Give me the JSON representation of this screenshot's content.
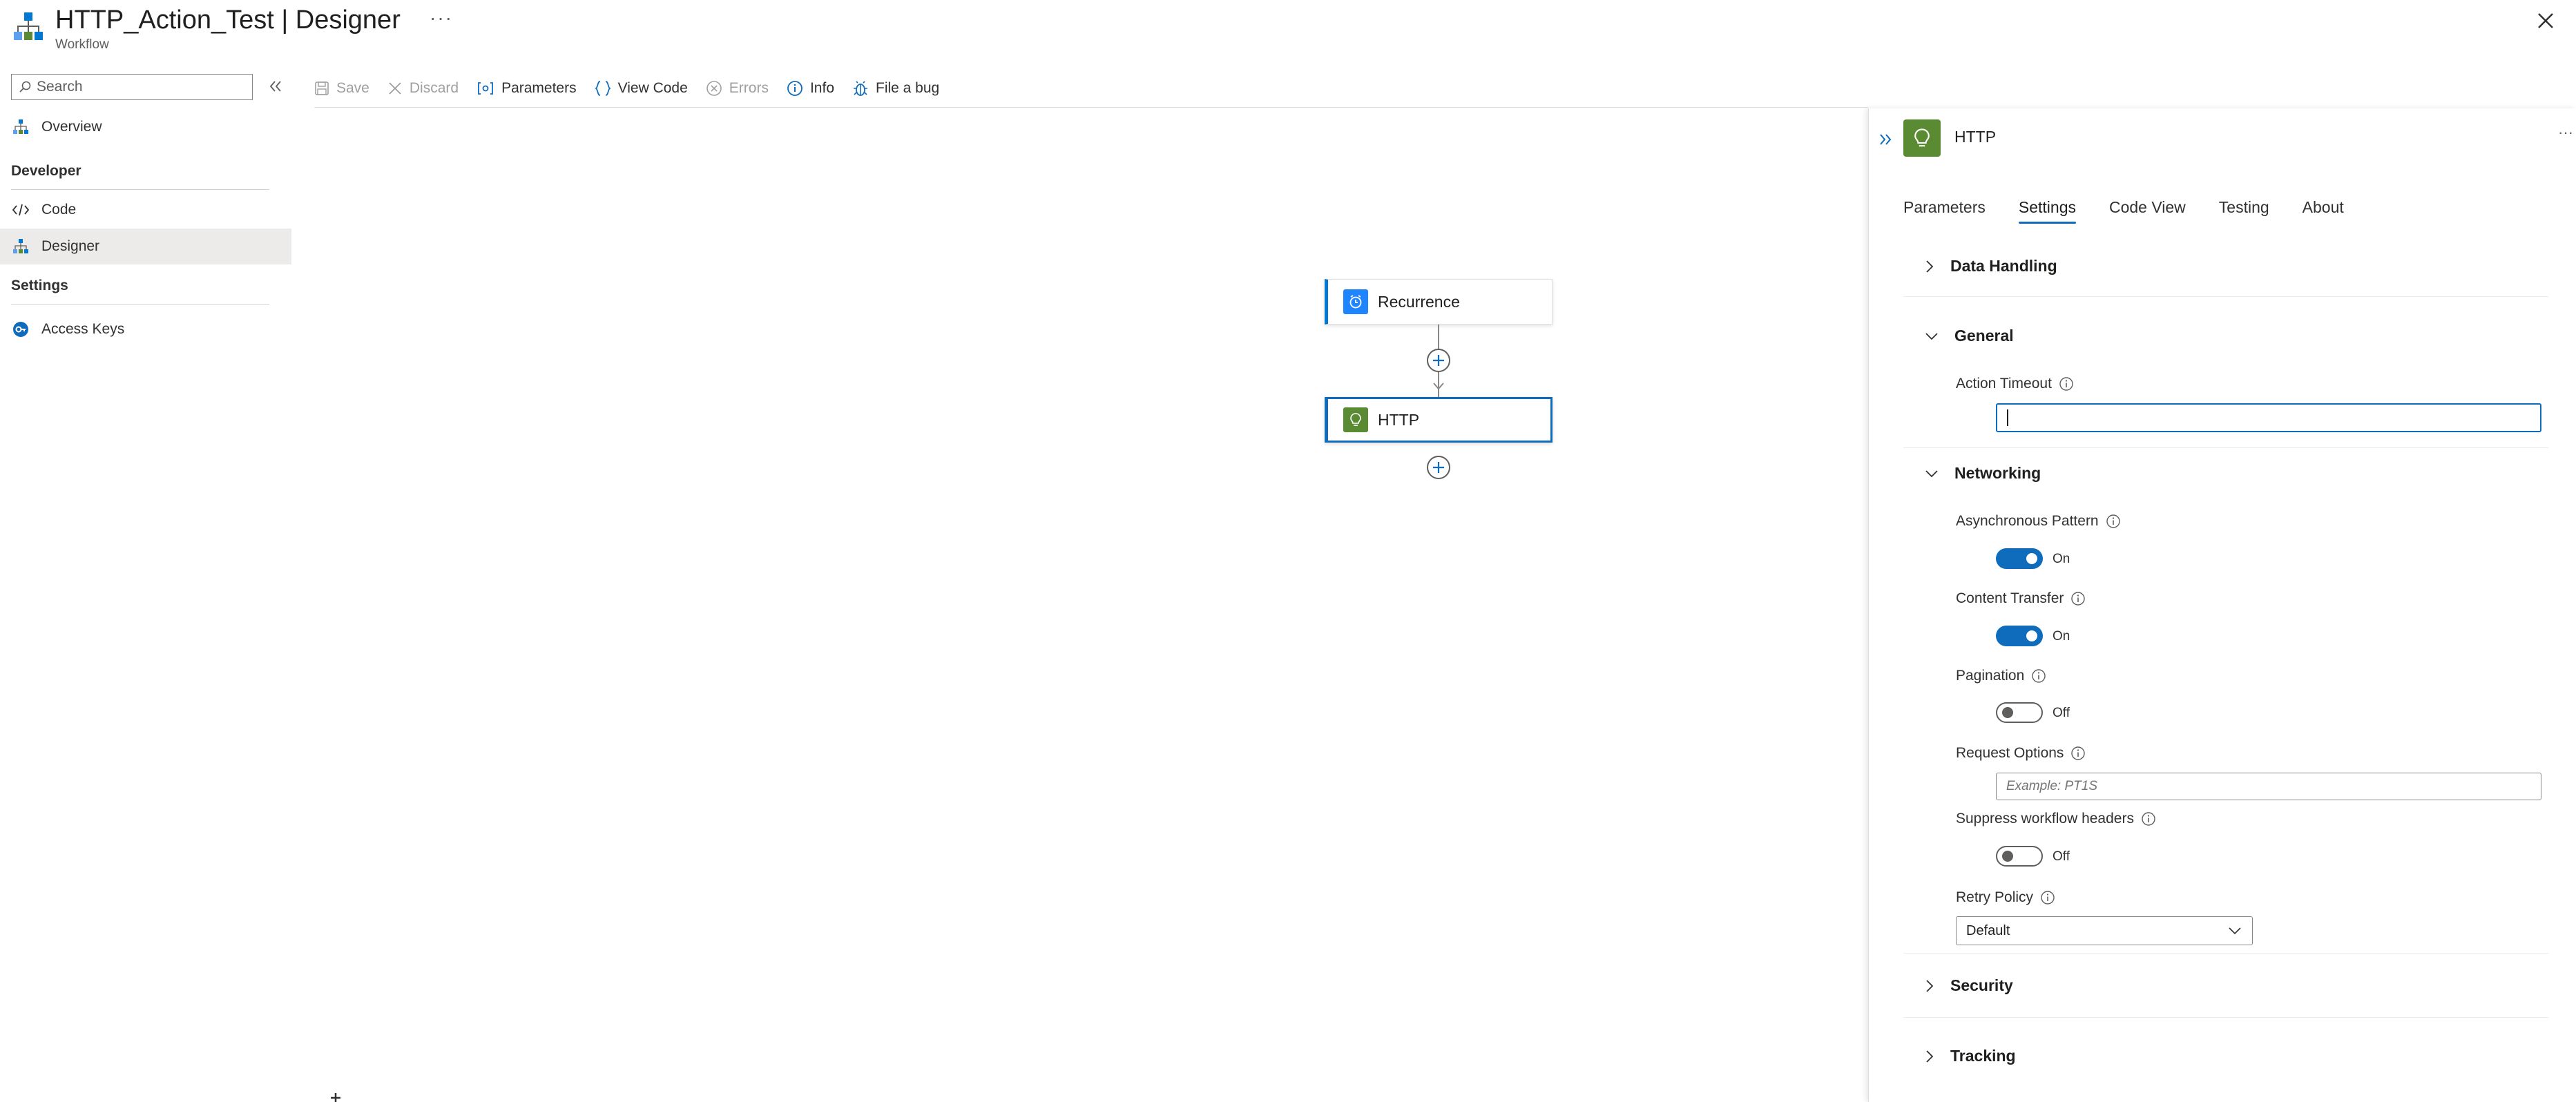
{
  "header": {
    "title": "HTTP_Action_Test | Designer",
    "subtitle": "Workflow",
    "more_label": "···"
  },
  "nav": {
    "search_placeholder": "Search",
    "items": [
      {
        "label": "Overview",
        "icon": "workflow-icon"
      },
      {
        "label": "Developer",
        "type": "group"
      },
      {
        "label": "Code",
        "icon": "code-icon"
      },
      {
        "label": "Designer",
        "icon": "designer-icon",
        "active": true
      },
      {
        "label": "Settings",
        "type": "group"
      },
      {
        "label": "Access Keys",
        "icon": "key-icon"
      }
    ]
  },
  "toolbar": {
    "save_label": "Save",
    "discard_label": "Discard",
    "parameters_label": "Parameters",
    "view_code_label": "View Code",
    "errors_label": "Errors",
    "info_label": "Info",
    "file_bug_label": "File a bug"
  },
  "canvas": {
    "nodes": [
      {
        "label": "Recurrence",
        "icon": "clock-icon",
        "color": "#1f85ff"
      },
      {
        "label": "HTTP",
        "icon": "http-bulb-icon",
        "color": "#5a8a32",
        "selected": true
      }
    ]
  },
  "panel": {
    "title": "HTTP",
    "more_label": "···",
    "tabs": [
      "Parameters",
      "Settings",
      "Code View",
      "Testing",
      "About"
    ],
    "active_tab": "Settings",
    "sections": {
      "data_handling": "Data Handling",
      "general": "General",
      "networking": "Networking",
      "security": "Security",
      "tracking": "Tracking"
    },
    "fields": {
      "action_timeout": {
        "label": "Action Timeout",
        "value": ""
      },
      "async_pattern": {
        "label": "Asynchronous Pattern",
        "state": "On"
      },
      "content_transfer": {
        "label": "Content Transfer",
        "state": "On"
      },
      "pagination": {
        "label": "Pagination",
        "state": "Off"
      },
      "request_options": {
        "label": "Request Options",
        "placeholder": "Example: PT1S"
      },
      "suppress_headers": {
        "label": "Suppress workflow headers",
        "state": "Off"
      },
      "retry_policy": {
        "label": "Retry Policy",
        "value": "Default"
      }
    }
  },
  "colors": {
    "accent": "#0f6cbd",
    "http_green": "#5a8a32",
    "recurrence_blue": "#1f85ff"
  }
}
